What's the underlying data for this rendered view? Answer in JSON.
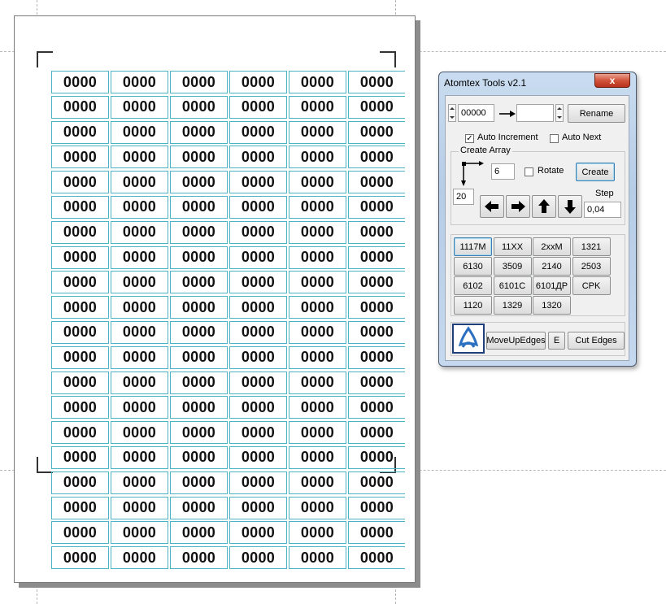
{
  "labels": {
    "cell_text": "0000",
    "rows": 20,
    "cols": 6
  },
  "tool_window": {
    "title": "Atomtex Tools v2.1",
    "close_glyph": "x",
    "start_value": "00000",
    "end_value": "",
    "rename_label": "Rename",
    "auto_increment": {
      "label": "Auto Increment",
      "checked": true
    },
    "auto_next": {
      "label": "Auto Next",
      "checked": false
    },
    "create_array": {
      "legend": "Create Array",
      "columns": "6",
      "rows": "20",
      "rotate": {
        "label": "Rotate",
        "checked": false
      },
      "create_label": "Create",
      "step_label": "Step",
      "step_value": "0,04"
    },
    "presets": [
      "1117M",
      "11XX",
      "2xxM",
      "1321",
      "6130",
      "3509",
      "2140",
      "2503",
      "6102",
      "6101C",
      "6101ДР",
      "CPK",
      "1120",
      "1329",
      "1320"
    ],
    "selected_preset": "1117M",
    "bottom": {
      "move_up_label": "MoveUpEdges",
      "e_label": "E",
      "cut_label": "Cut Edges"
    }
  },
  "colors": {
    "label_border": "#4bb3c4",
    "window_frame": "#b7cde6",
    "close_red": "#d2543c"
  }
}
